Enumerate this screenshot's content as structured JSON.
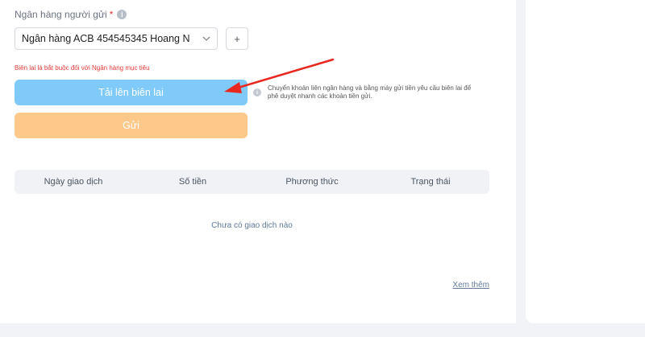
{
  "form": {
    "sender_bank_label": "Ngân hàng người gửi",
    "required_mark": "*",
    "info_icon": "info-icon",
    "selected_bank": "Ngân hàng ACB 454545345 Hoang N",
    "add_button_label": "+",
    "error_message": "Biên lai là bắt buộc đối với Ngân hàng mục tiêu",
    "upload_button_label": "Tải lên biên lai",
    "upload_hint": "Chuyển khoản liên ngân hàng và bằng máy gửi tiền yêu cầu biên lai để phê duyệt nhanh các khoản tiền gửi.",
    "submit_button_label": "Gửi"
  },
  "transactions": {
    "columns": [
      "Ngày giao dịch",
      "Số tiền",
      "Phương thức",
      "Trạng thái"
    ],
    "empty_message": "Chưa có giao dịch nào",
    "view_more_label": "Xem thêm"
  },
  "colors": {
    "upload_button": "#7fcaf8",
    "submit_button": "#fcc98b",
    "error": "#e53935",
    "annotation_arrow": "#e8281f"
  }
}
